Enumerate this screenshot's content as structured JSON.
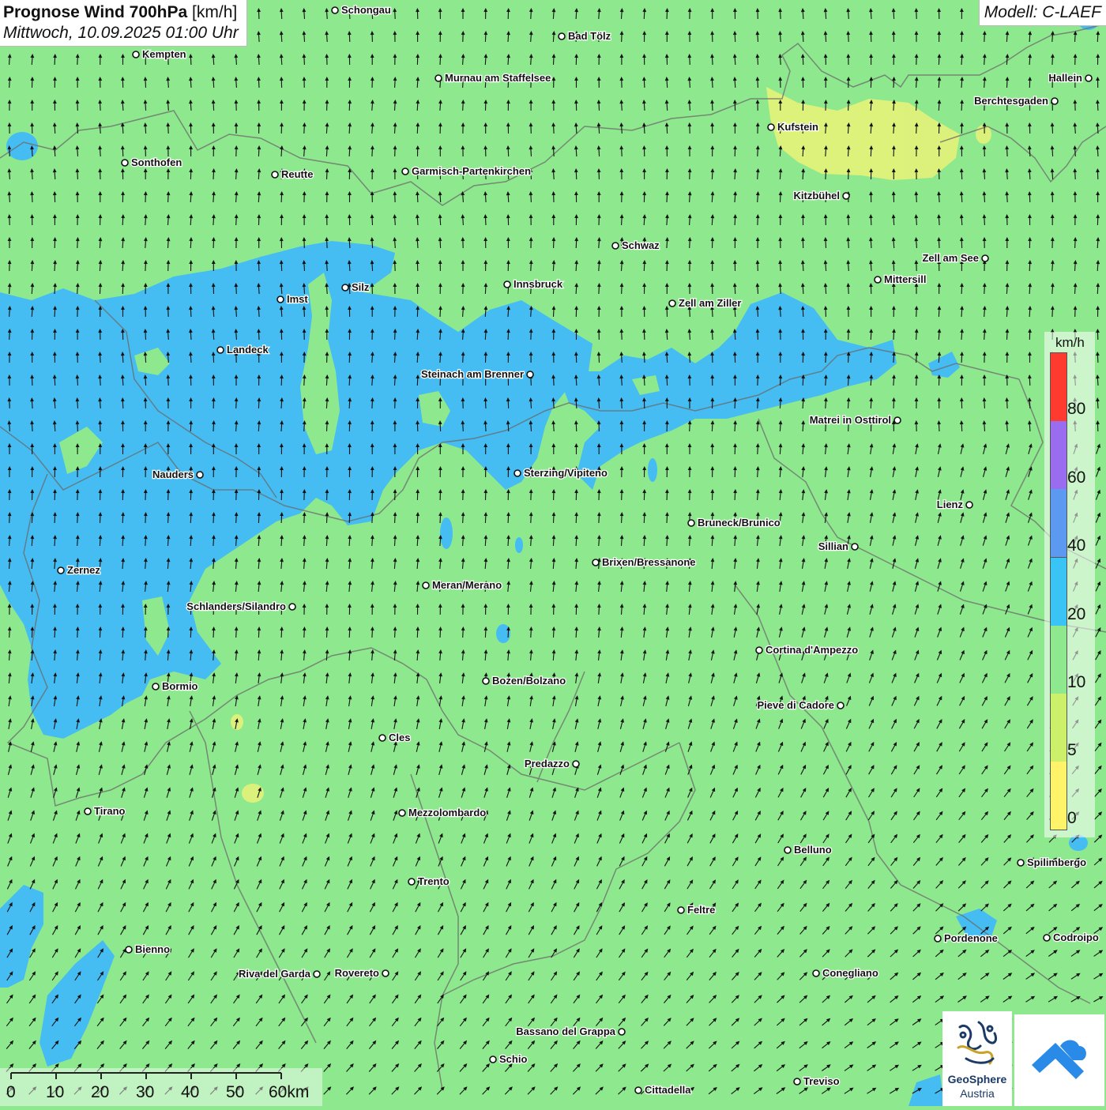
{
  "title": {
    "main": "Prognose Wind 700hPa",
    "unit": "[km/h]",
    "date": "Mittwoch, 10.09.2025 01:00 Uhr"
  },
  "model": "Modell: C-LAEF",
  "legend": {
    "unit": "km/h",
    "labels": [
      "80",
      "60",
      "40",
      "20",
      "10",
      "5",
      "0"
    ],
    "colors": [
      "#ff3b30",
      "#9a6cf0",
      "#5b9af0",
      "#3ac4f5",
      "#8ee88e",
      "#cdf06a",
      "#fff36a"
    ]
  },
  "scale": {
    "labels": [
      "0",
      "10",
      "20",
      "30",
      "40",
      "50",
      "60km"
    ]
  },
  "logo": {
    "geosphere_line1": "GeoSphere",
    "geosphere_line2": "Austria"
  },
  "colors": {
    "calm_green": "#8ee88e",
    "band_20_40": "#45bdf3",
    "band_5_10": "#e0f27a",
    "arrow": "#111111",
    "border": "#666666"
  },
  "cities": [
    {
      "name": "Schongau"
    },
    {
      "name": "Bad Tölz"
    },
    {
      "name": "Kempten"
    },
    {
      "name": "Hallein"
    },
    {
      "name": "Murnau am Staffelsee"
    },
    {
      "name": "Berchtesgaden"
    },
    {
      "name": "Kufstein"
    },
    {
      "name": "Sonthofen"
    },
    {
      "name": "Reutte"
    },
    {
      "name": "Garmisch-Partenkirchen"
    },
    {
      "name": "Kitzbühel"
    },
    {
      "name": "Schwaz"
    },
    {
      "name": "Zell am See"
    },
    {
      "name": "Silz"
    },
    {
      "name": "Innsbruck"
    },
    {
      "name": "Mittersill"
    },
    {
      "name": "Imst"
    },
    {
      "name": "Zell am Ziller"
    },
    {
      "name": "Landeck"
    },
    {
      "name": "Steinach am Brenner"
    },
    {
      "name": "Matrei in Osttirol"
    },
    {
      "name": "Nauders"
    },
    {
      "name": "Sterzing/Vipiteno"
    },
    {
      "name": "Lienz"
    },
    {
      "name": "Bruneck/Brunico"
    },
    {
      "name": "Sillian"
    },
    {
      "name": "Zernez"
    },
    {
      "name": "Brixen/Bressanone"
    },
    {
      "name": "Meran/Merano"
    },
    {
      "name": "Schlanders/Silandro"
    },
    {
      "name": "Cortina d'Ampezzo"
    },
    {
      "name": "Bozen/Bolzano"
    },
    {
      "name": "Bormio"
    },
    {
      "name": "Pieve di Cadore"
    },
    {
      "name": "Cles"
    },
    {
      "name": "Predazzo"
    },
    {
      "name": "Tirano"
    },
    {
      "name": "Mezzolombardo"
    },
    {
      "name": "Belluno"
    },
    {
      "name": "Spilimbergo"
    },
    {
      "name": "Trento"
    },
    {
      "name": "Feltre"
    },
    {
      "name": "Pordenone"
    },
    {
      "name": "Codroipo"
    },
    {
      "name": "Bienno"
    },
    {
      "name": "Riva del Garda"
    },
    {
      "name": "Rovereto"
    },
    {
      "name": "Conegliano"
    },
    {
      "name": "Bassano del Grappa"
    },
    {
      "name": "Schio"
    },
    {
      "name": "Treviso"
    },
    {
      "name": "Cittadella"
    }
  ]
}
